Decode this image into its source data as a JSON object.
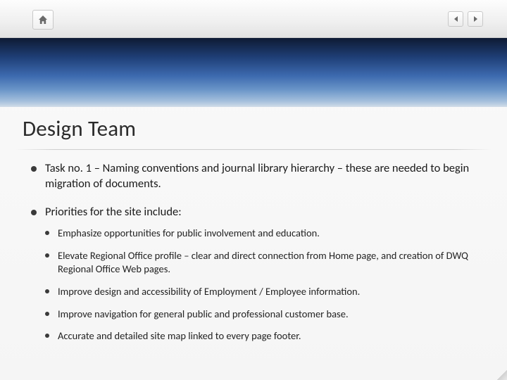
{
  "title": "Design Team",
  "bullets": [
    {
      "text": "Task no. 1 – Naming conventions and journal library hierarchy – these are needed to begin migration of documents."
    },
    {
      "text": "Priorities for the site include:",
      "children": [
        "Emphasize opportunities for public involvement and education.",
        "Elevate Regional Office profile – clear and direct connection from Home page, and creation of DWQ Regional Office Web pages.",
        "Improve design and accessibility of Employment / Employee information.",
        "Improve navigation for general public and professional customer base.",
        "Accurate and detailed site map linked to every page footer."
      ]
    }
  ],
  "icons": {
    "home": "home-icon",
    "prev": "previous-arrow",
    "next": "next-arrow"
  }
}
